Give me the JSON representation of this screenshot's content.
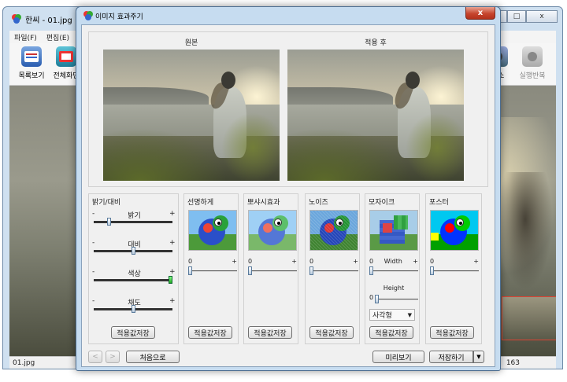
{
  "main_window": {
    "title": "한씨 - 01.jpg",
    "menu": [
      "파일(F)",
      "편집(E)"
    ],
    "toolbar_left": [
      "목록보기",
      "전체화면"
    ],
    "toolbar_right": [
      "취소",
      "실행반복"
    ],
    "status_left": "01.jpg",
    "status_right": "163",
    "window_controls": [
      "_",
      "□",
      "x"
    ]
  },
  "dialog": {
    "title": "이미지 효과주기",
    "close_symbol": "x",
    "preview": {
      "original_label": "원본",
      "after_label": "적용 후"
    },
    "groups": {
      "brightness": {
        "title": "밝기/대비",
        "sliders": [
          {
            "label": "밝기",
            "min": "-",
            "max": "+",
            "position": 0.18
          },
          {
            "label": "대비",
            "min": "-",
            "max": "+",
            "position": 0.5
          },
          {
            "label": "색상",
            "min": "-",
            "max": "+",
            "position": 1.0
          },
          {
            "label": "채도",
            "min": "-",
            "max": "+",
            "position": 0.5
          }
        ],
        "save": "적용값저장"
      },
      "sharpen": {
        "title": "선명하게",
        "value": "0",
        "max": "+",
        "save": "적용값저장"
      },
      "blur": {
        "title": "뽀샤시효과",
        "value": "0",
        "max": "+",
        "save": "적용값저장"
      },
      "noise": {
        "title": "노이즈",
        "value": "0",
        "max": "+",
        "save": "적용값저장"
      },
      "mosaic": {
        "title": "모자이크",
        "width_label": "Width",
        "width_value": "0",
        "height_label": "Height",
        "height_value": "0",
        "max": "+",
        "shape": "사각형",
        "save": "적용값저장"
      },
      "poster": {
        "title": "포스터",
        "value": "0",
        "max": "+",
        "save": "적용값저장"
      }
    },
    "footer": {
      "prev": "<",
      "next": ">",
      "reset": "처음으로",
      "preview": "미리보기",
      "save": "저장하기",
      "save_dropdown": "▼"
    }
  }
}
